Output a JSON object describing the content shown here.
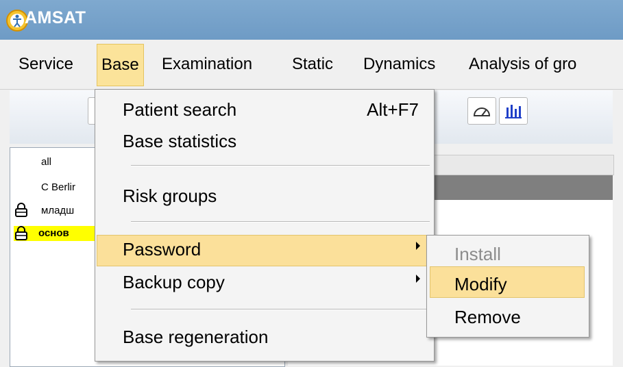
{
  "app": {
    "title": "AMSAT"
  },
  "menubar": {
    "items": [
      {
        "label": "Service"
      },
      {
        "label": "Base"
      },
      {
        "label": "Examination"
      },
      {
        "label": "Static"
      },
      {
        "label": "Dynamics"
      },
      {
        "label": "Analysis of gro"
      }
    ],
    "active": "Base"
  },
  "toolbar": {
    "icons": [
      "gauge-icon",
      "bar-chart-icon"
    ]
  },
  "tree": {
    "items": [
      {
        "label": "all",
        "locked": false
      },
      {
        "label": "C Berlir",
        "locked": false
      },
      {
        "label": "младш",
        "locked": true
      },
      {
        "label": "основ",
        "locked": true,
        "selected": true
      }
    ]
  },
  "base_menu": {
    "patient_search": "Patient search",
    "patient_search_shortcut": "Alt+F7",
    "base_statistics": "Base statistics",
    "risk_groups": "Risk groups",
    "password": "Password",
    "backup_copy": "Backup copy",
    "base_regeneration": "Base regeneration"
  },
  "password_submenu": {
    "install": "Install",
    "modify": "Modify",
    "remove": "Remove"
  },
  "colors": {
    "highlight": "#fbe09a",
    "titlebar": "#7fa9cf",
    "selection": "#ffff00"
  }
}
